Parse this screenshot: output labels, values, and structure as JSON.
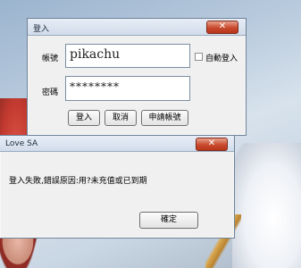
{
  "login_window": {
    "title": "登入",
    "close_symbol": "✕",
    "account_label": "帳號",
    "account_value": "pikachu",
    "password_label": "密碼",
    "password_value": "********",
    "auto_login_label": "自動登入",
    "login_button": "登入",
    "cancel_button": "取消",
    "apply_button": "申請帳號"
  },
  "error_dialog": {
    "title": "Love SA",
    "close_symbol": "✕",
    "message": "登入失敗,錯誤原因:用?未充值或已到期",
    "ok_button": "確定"
  },
  "colors": {
    "close_button": "#c84a2e",
    "titlebar": "#d2dcea"
  },
  "icons": [
    "close-icon",
    "checkbox-unchecked"
  ]
}
